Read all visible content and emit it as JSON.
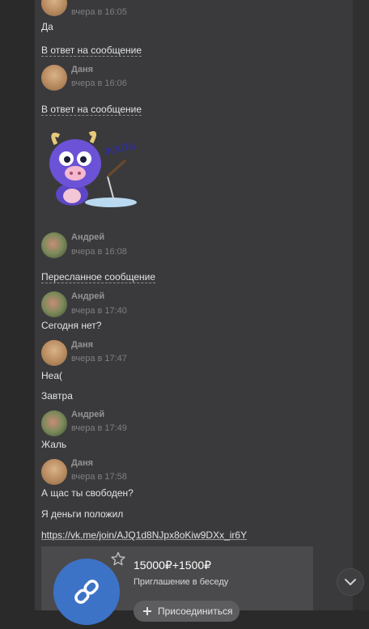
{
  "messages": [
    {
      "time": "вчера в 16:05",
      "text": "Да",
      "reply_label": "В ответ на сообщение"
    },
    {
      "author": "Даня",
      "time": "вчера в 16:06",
      "reply_label": "В ответ на сообщение",
      "sticker": "sticker-cow-fishing",
      "sticker_text": "ЖАЛЬ"
    },
    {
      "author": "Андрей",
      "time": "вчера в 16:08",
      "forward_label": "Пересланное сообщение"
    },
    {
      "author": "Андрей",
      "time": "вчера в 17:40",
      "text": "Сегодня нет?"
    },
    {
      "author": "Даня",
      "time": "вчера в 17:47",
      "texts": [
        "Неа(",
        "Завтра"
      ]
    },
    {
      "author": "Андрей",
      "time": "вчера в 17:49",
      "text": "Жаль"
    },
    {
      "author": "Даня",
      "time": "вчера в 17:58",
      "texts": [
        "А щас ты свободен?",
        "Я деньги положил"
      ],
      "link": "https://vk.me/join/AJQ1d8NJpx8oKiw9DXx_ir6Y"
    }
  ],
  "invite_card": {
    "title": "15000₽+1500₽",
    "subtitle": "Приглашение в беседу",
    "button_label": "Присоединиться"
  },
  "colors": {
    "accent": "#3d73c6",
    "background": "#3a3a3c"
  }
}
